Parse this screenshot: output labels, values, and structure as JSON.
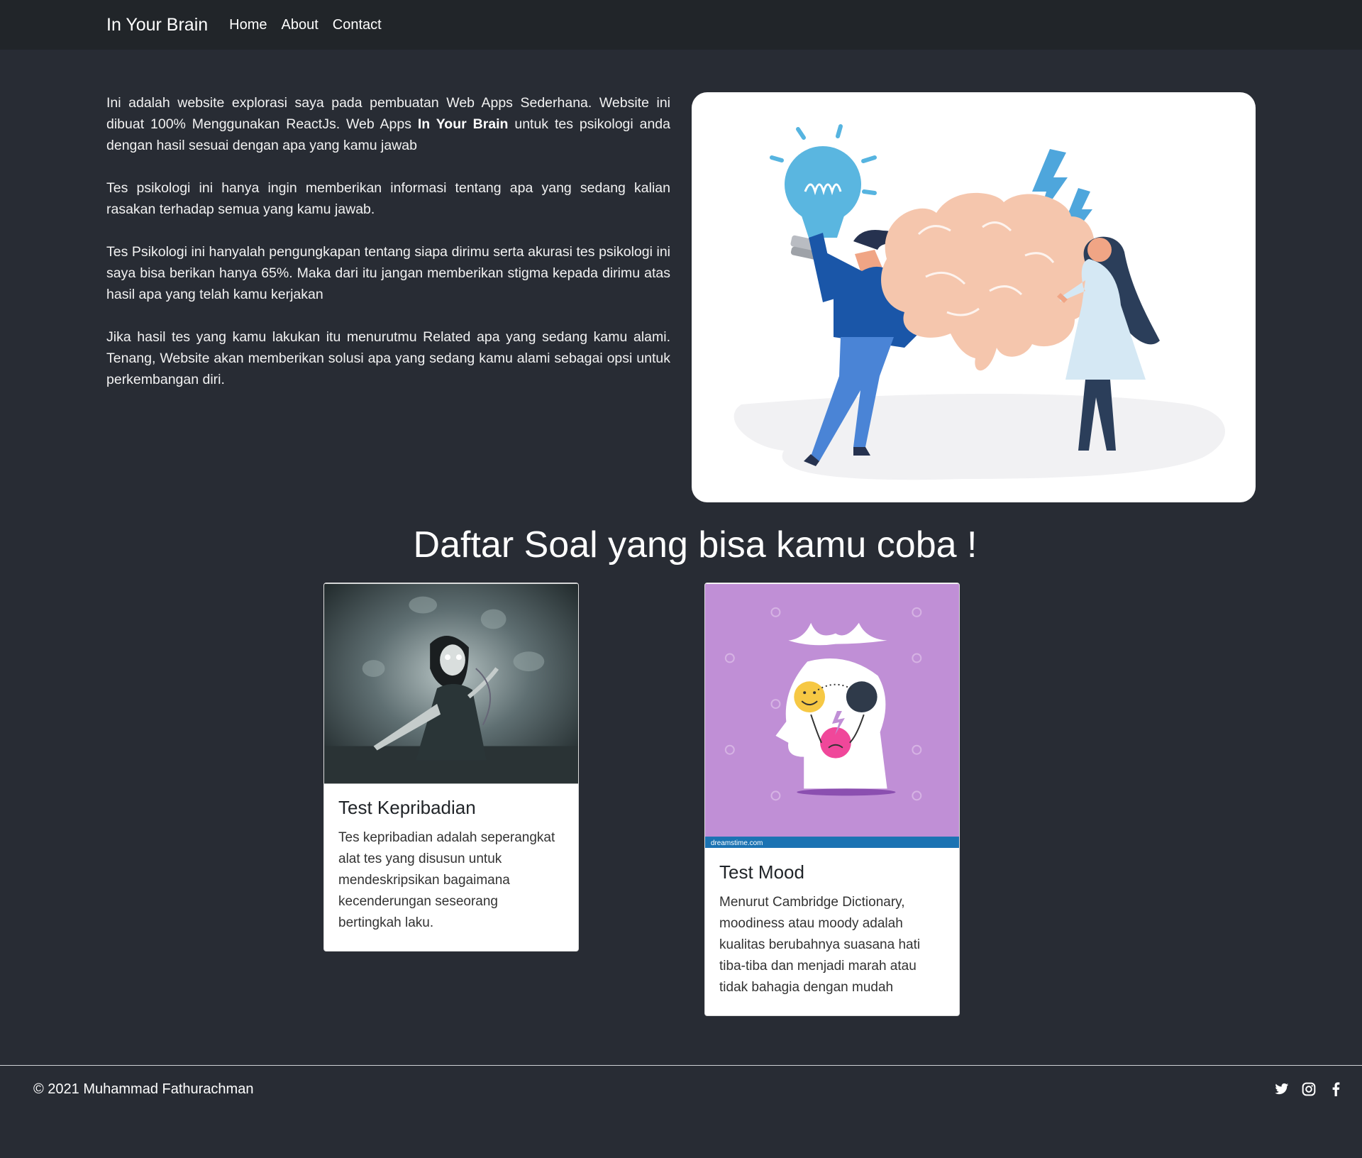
{
  "navbar": {
    "brand": "In Your Brain",
    "links": [
      "Home",
      "About",
      "Contact"
    ]
  },
  "intro": {
    "p1_a": "Ini adalah website explorasi saya pada pembuatan Web Apps Sederhana. Website ini dibuat 100% Menggunakan ReactJs. Web Apps ",
    "p1_bold": "In Your Brain",
    "p1_b": " untuk tes psikologi anda dengan hasil sesuai dengan apa yang kamu jawab",
    "p2": "Tes psikologi ini hanya ingin memberikan informasi tentang apa yang sedang kalian rasakan terhadap semua yang kamu jawab.",
    "p3": "Tes Psikologi ini hanyalah pengungkapan tentang siapa dirimu serta akurasi tes psikologi ini saya bisa berikan hanya 65%. Maka dari itu jangan memberikan stigma kepada dirimu atas hasil apa yang telah kamu kerjakan",
    "p4": "Jika hasil tes yang kamu lakukan itu menurutmu Related apa yang sedang kamu alami. Tenang, Website akan memberikan solusi apa yang sedang kamu alami sebagai opsi untuk perkembangan diri."
  },
  "section_title": "Daftar Soal yang bisa kamu coba !",
  "cards": [
    {
      "title": "Test Kepribadian",
      "text": "Tes kepribadian adalah seperangkat alat tes yang disusun untuk mendeskripsikan bagaimana kecenderungan seseorang bertingkah laku."
    },
    {
      "title": "Test Mood",
      "text": "Menurut Cambridge Dictionary, moodiness atau moody adalah kualitas berubahnya suasana hati tiba-tiba dan menjadi marah atau tidak bahagia dengan mudah",
      "watermark": "dreamstime.com"
    }
  ],
  "footer": {
    "copyright": "© 2021 Muhammad Fathurachman",
    "socials": [
      "twitter-icon",
      "instagram-icon",
      "facebook-icon"
    ]
  },
  "colors": {
    "background": "#282c34",
    "navbar": "#212529",
    "mood_card_bg": "#c08fd6",
    "brain": "#f4c2a8"
  }
}
